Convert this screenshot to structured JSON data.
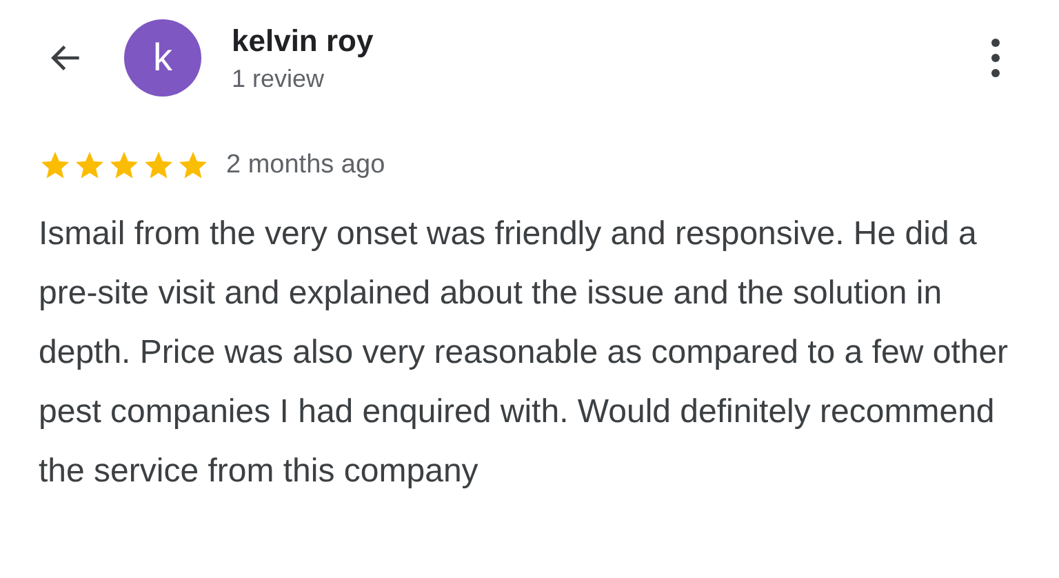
{
  "reviewer": {
    "avatar_letter": "k",
    "name": "kelvin roy",
    "review_count": "1 review"
  },
  "review": {
    "stars": 5,
    "time": "2 months ago",
    "text": "Ismail from the very onset was friendly and responsive. He did a pre-site visit and explained about the issue and the solution in depth. Price was also very reasonable as compared to a few other pest companies I had enquired with. Would definitely recommend the service from this company"
  }
}
